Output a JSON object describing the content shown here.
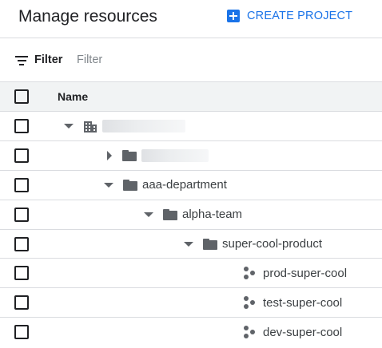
{
  "header": {
    "title": "Manage resources",
    "create_project_label": "CREATE PROJECT"
  },
  "filter": {
    "label": "Filter",
    "placeholder": "Filter",
    "value": ""
  },
  "table": {
    "column_name": "Name",
    "rows": [
      {
        "type": "organization",
        "label": "",
        "expanded": true,
        "redacted": true
      },
      {
        "type": "folder",
        "label": "",
        "expanded": false,
        "redacted": true
      },
      {
        "type": "folder",
        "label": "aaa-department",
        "expanded": true
      },
      {
        "type": "folder",
        "label": "alpha-team",
        "expanded": true
      },
      {
        "type": "folder",
        "label": "super-cool-product",
        "expanded": true
      },
      {
        "type": "project",
        "label": "prod-super-cool"
      },
      {
        "type": "project",
        "label": "test-super-cool"
      },
      {
        "type": "project",
        "label": "dev-super-cool"
      }
    ]
  },
  "colors": {
    "accent": "#1a73e8",
    "icon": "#5f6368",
    "divider": "#dadce0",
    "header_bg": "#f1f3f4"
  }
}
